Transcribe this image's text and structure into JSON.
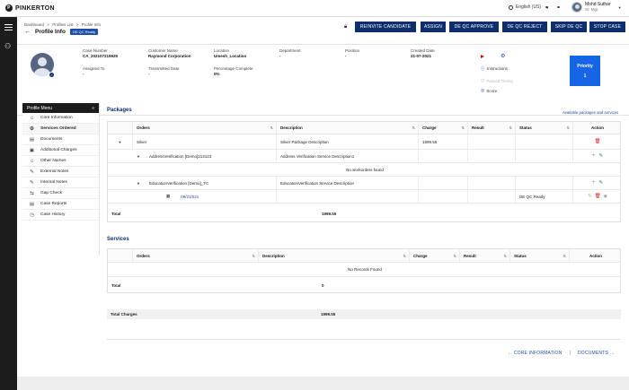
{
  "brand": {
    "name": "PINKERTON",
    "mark": "P"
  },
  "topbar": {
    "language": "English (US)",
    "user_name": "Mohd Suthar",
    "user_role": "Sr. Mgr."
  },
  "breadcrumb": [
    "Dashboard",
    ">",
    "Profiles List",
    ">",
    "Profile Info"
  ],
  "page": {
    "title": "Profile Info",
    "status_badge": "DE QC Ready"
  },
  "actions": [
    "REINVITE CANDIDATE",
    "ASSIGN",
    "DE QC APPROVE",
    "DE QC REJECT",
    "SKIP DE QC",
    "STOP CASE"
  ],
  "info": {
    "case_number": {
      "label": "Case Number",
      "value": "CA_202107215925"
    },
    "customer_name": {
      "label": "Customer Name",
      "value": "Raymond Corporation"
    },
    "location": {
      "label": "Location",
      "value": "Umesh_Location"
    },
    "department": {
      "label": "Department",
      "value": "-"
    },
    "position": {
      "label": "Position",
      "value": "-"
    },
    "created_date": {
      "label": "Created Date",
      "value": "21-07-2021"
    },
    "assigned_to": {
      "label": "Assigned To",
      "value": "-"
    },
    "transmitted_date": {
      "label": "Transmitted Date",
      "value": "-"
    },
    "percentage_complete": {
      "label": "Percentage Complete",
      "value": "0%"
    },
    "instructions": "Instructions",
    "passed_timing": "Passed Timing",
    "score": "Score",
    "priority_label": "Priority",
    "priority_value": "1"
  },
  "profile_menu": {
    "title": "Profile Menu",
    "collapse": "«",
    "items": [
      {
        "label": "Core Information",
        "icon": "person-icon",
        "glyph": "☺"
      },
      {
        "label": "Services Ordered",
        "icon": "services-icon",
        "glyph": "⚙"
      },
      {
        "label": "Documents",
        "icon": "document-icon",
        "glyph": "▤"
      },
      {
        "label": "Additional Charges",
        "icon": "charges-icon",
        "glyph": "▣"
      },
      {
        "label": "Other Names",
        "icon": "names-icon",
        "glyph": "☺"
      },
      {
        "label": "External Notes",
        "icon": "note-icon",
        "glyph": "✎"
      },
      {
        "label": "Internal Notes",
        "icon": "note-icon",
        "glyph": "✎"
      },
      {
        "label": "Gap Check",
        "icon": "gap-icon",
        "glyph": "⇆"
      },
      {
        "label": "Case Reports",
        "icon": "report-icon",
        "glyph": "▤"
      },
      {
        "label": "Case History",
        "icon": "history-icon",
        "glyph": "◷"
      }
    ]
  },
  "packages": {
    "title": "Packages",
    "available_link": "Available packages and services",
    "headers": [
      "Orders",
      "Description",
      "Charge",
      "Result",
      "Status",
      "Action"
    ],
    "rows": {
      "silver": {
        "order": "Silver",
        "description": "Silver Package Description",
        "charge": "1999.55"
      },
      "address": {
        "order": "AddressVerification [Demo]213123",
        "description": "Address Verification Service Description1"
      },
      "no_workorders": "No workorders found",
      "education": {
        "order": "EducationVerification [Demo]_TC",
        "description": "EducationVerification Service Description"
      },
      "workorder": {
        "order": "09/21/021",
        "status": "DE QC Ready"
      }
    },
    "total_label": "Total",
    "total_value": "1999.55"
  },
  "services": {
    "title": "Services",
    "headers": [
      "Orders",
      "Description",
      "Charge",
      "Result",
      "Status",
      "Action"
    ],
    "empty": "No Records Found",
    "total_label": "Total",
    "total_value": "0"
  },
  "total_charges": {
    "label": "Total Charges",
    "value": "1999.55"
  },
  "footer_nav": {
    "prev": "← CORE INFORMATION",
    "sep": "|",
    "next": "DOCUMENTS →"
  }
}
